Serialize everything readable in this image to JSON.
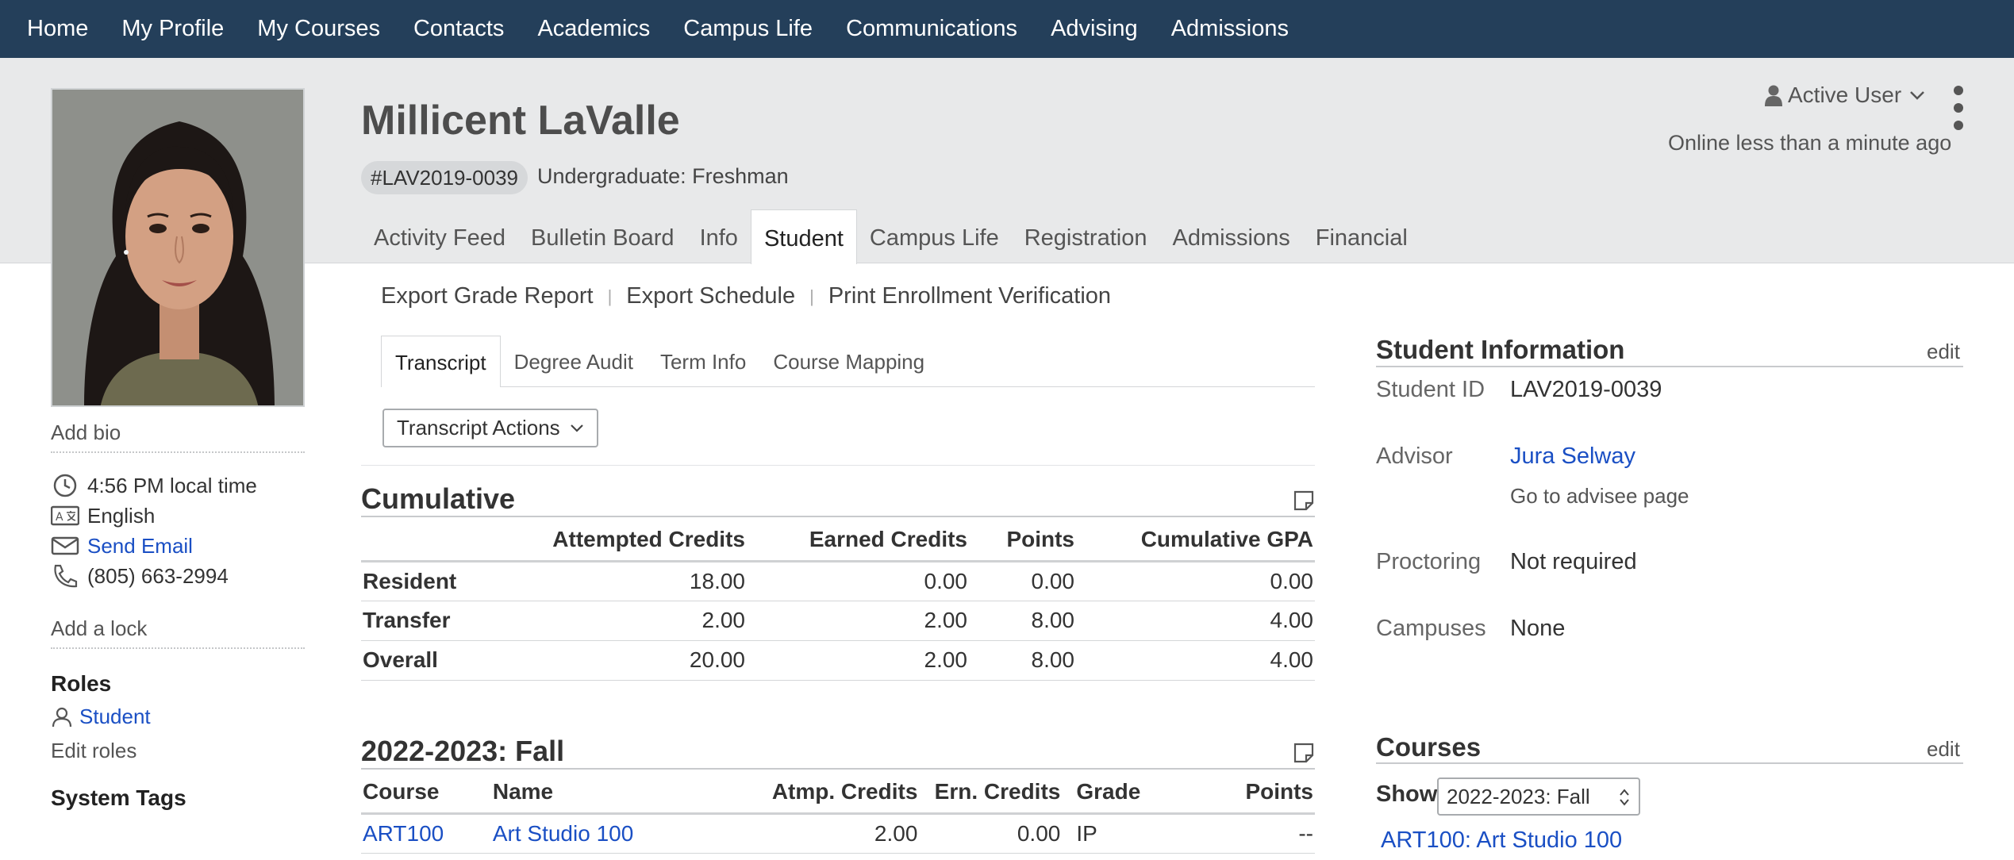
{
  "topnav": [
    "Home",
    "My Profile",
    "My Courses",
    "Contacts",
    "Academics",
    "Campus Life",
    "Communications",
    "Advising",
    "Admissions"
  ],
  "profile": {
    "name": "Millicent LaValle",
    "id_badge": "#LAV2019-0039",
    "level": "Undergraduate: Freshman",
    "status": "Active User",
    "online": "Online less than a minute ago"
  },
  "main_tabs": [
    "Activity Feed",
    "Bulletin Board",
    "Info",
    "Student",
    "Campus Life",
    "Registration",
    "Admissions",
    "Financial"
  ],
  "sidebar": {
    "add_bio": "Add bio",
    "local_time": "4:56 PM local time",
    "language": "English",
    "send_email": "Send Email",
    "phone": "(805) 663-2994",
    "add_lock": "Add a lock",
    "roles_title": "Roles",
    "role": "Student",
    "edit_roles": "Edit roles",
    "system_tags": "System Tags"
  },
  "actions": [
    "Export Grade Report",
    "Export Schedule",
    "Print Enrollment Verification"
  ],
  "sub_tabs": [
    "Transcript",
    "Degree Audit",
    "Term Info",
    "Course Mapping"
  ],
  "transcript_actions": "Transcript Actions",
  "cumulative": {
    "title": "Cumulative",
    "headers": [
      "",
      "Attempted Credits",
      "Earned Credits",
      "Points",
      "Cumulative GPA"
    ],
    "rows": [
      [
        "Resident",
        "18.00",
        "0.00",
        "0.00",
        "0.00"
      ],
      [
        "Transfer",
        "2.00",
        "2.00",
        "8.00",
        "4.00"
      ],
      [
        "Overall",
        "20.00",
        "2.00",
        "8.00",
        "4.00"
      ]
    ]
  },
  "term": {
    "title": "2022-2023: Fall",
    "headers": [
      "Course",
      "Name",
      "Atmp. Credits",
      "Ern. Credits",
      "Grade",
      "Points"
    ],
    "rows": [
      [
        "ART100",
        "Art Studio 100",
        "2.00",
        "0.00",
        "IP",
        "--"
      ]
    ]
  },
  "student_info": {
    "title": "Student Information",
    "edit": "edit",
    "student_id_label": "Student ID",
    "student_id": "LAV2019-0039",
    "advisor_label": "Advisor",
    "advisor": "Jura Selway",
    "advisee_page": "Go to advisee page",
    "proctoring_label": "Proctoring",
    "proctoring": "Not required",
    "campuses_label": "Campuses",
    "campuses": "None"
  },
  "courses": {
    "title": "Courses",
    "edit": "edit",
    "show_label": "Show",
    "show_value": "2022-2023: Fall",
    "first_course": "ART100: Art Studio 100"
  },
  "colors": {
    "nav_bg": "#243f5a",
    "header_bg": "#e8e9ea",
    "link": "#1a4fc4"
  }
}
